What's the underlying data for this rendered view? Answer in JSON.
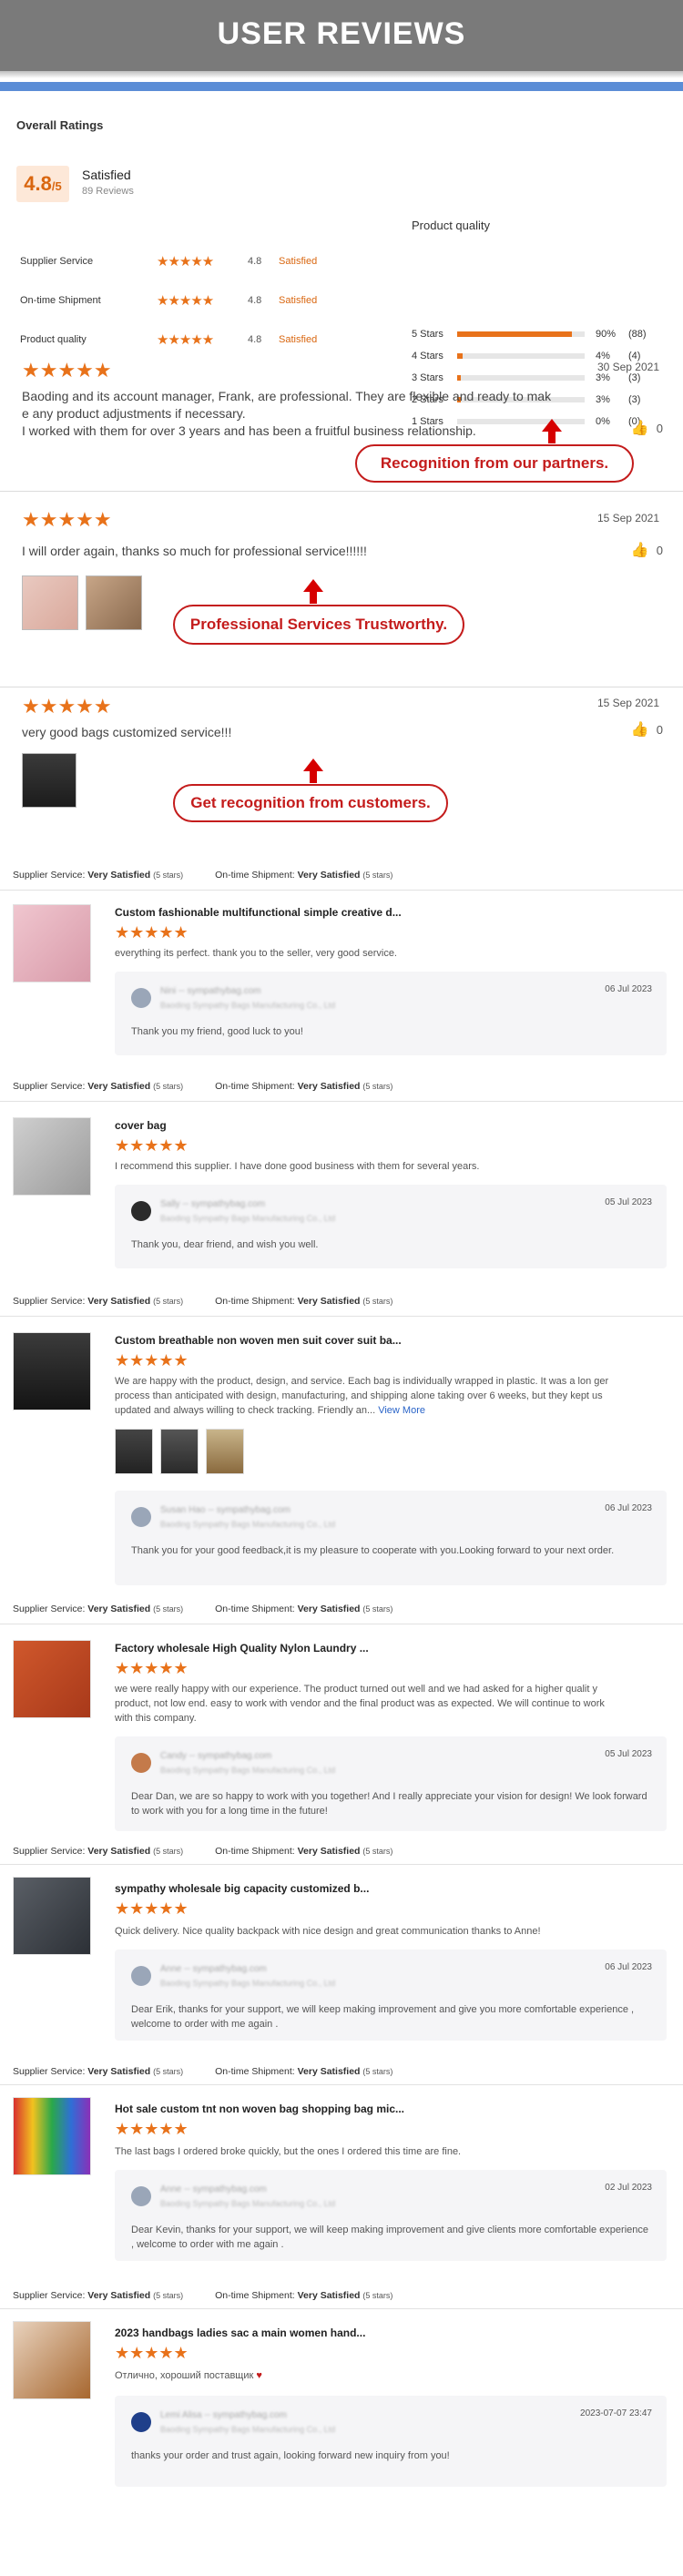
{
  "banner": {
    "title": "USER REVIEWS"
  },
  "overall": {
    "heading": "Overall Ratings",
    "score": "4.8",
    "score_of": "/5",
    "satisfaction": "Satisfied",
    "review_count": "89 Reviews",
    "categories": [
      {
        "name": "Supplier Service",
        "score": "4.8",
        "word": "Satisfied"
      },
      {
        "name": "On-time Shipment",
        "score": "4.8",
        "word": "Satisfied"
      },
      {
        "name": "Product quality",
        "score": "4.8",
        "word": "Satisfied"
      }
    ],
    "product_quality": {
      "title": "Product quality",
      "rows": [
        {
          "label": "5 Stars",
          "fraction": 0.9,
          "pct": "90%",
          "count": "(88)"
        },
        {
          "label": "4 Stars",
          "fraction": 0.04,
          "pct": "4%",
          "count": "(4)"
        },
        {
          "label": "3 Stars",
          "fraction": 0.03,
          "pct": "3%",
          "count": "(3)"
        },
        {
          "label": "2 Stars",
          "fraction": 0.03,
          "pct": "3%",
          "count": "(3)"
        },
        {
          "label": "1 Stars",
          "fraction": 0.0,
          "pct": "0%",
          "count": "(0)"
        }
      ]
    }
  },
  "top_reviews": [
    {
      "date": "30 Sep 2021",
      "text_line1": "Baoding and its account manager, Frank, are professional. They are flexible and ready to mak",
      "text_line2": "e any product adjustments if necessary.",
      "text_line3": "I worked with them for over 3 years and has been a fruitful business relationship.",
      "likes": "0",
      "callout": "Recognition from our partners."
    },
    {
      "date": "15 Sep 2021",
      "text_line1": "I will order again, thanks so much for professional service!!!!!!",
      "likes": "0",
      "callout": "Professional Services Trustworthy."
    },
    {
      "date": "15 Sep 2021",
      "text_line1": "very good bags customized service!!!",
      "likes": "0",
      "callout": "Get recognition from customers."
    }
  ],
  "service_line": {
    "supplier_label": "Supplier Service:",
    "supplier_value": "Very Satisfied",
    "supplier_stars": "(5 stars)",
    "shipment_label": "On-time Shipment:",
    "shipment_value": "Very Satisfied",
    "shipment_stars": "(5 stars)"
  },
  "product_reviews": [
    {
      "title": "Custom fashionable multifunctional simple creative d...",
      "text": "everything its perfect. thank you to the seller, very good service.",
      "reply_name": "Nini -- sympathybag.com",
      "reply_company": "Baoding Sympathy Bags Manufacturing Co., Ltd",
      "reply_date": "06 Jul 2023",
      "reply_text": "Thank you my friend, good luck to you!"
    },
    {
      "title": "cover bag",
      "text": "I recommend this supplier. I have done good business with them for several years.",
      "reply_name": "Sally -- sympathybag.com",
      "reply_company": "Baoding Sympathy Bags Manufacturing Co., Ltd",
      "reply_date": "05 Jul 2023",
      "reply_text": "Thank you, dear friend, and wish you well."
    },
    {
      "title": "Custom breathable non woven men suit cover suit ba...",
      "text": "We are happy with the product, design, and service. Each bag is individually wrapped in plastic. It was a lon ger process than anticipated with design, manufacturing, and shipping alone taking over 6 weeks, but they kept us updated and always willing to check tracking. Friendly an...",
      "more": "View More",
      "reply_name": "Susan Hao -- sympathybag.com",
      "reply_company": "Baoding Sympathy Bags Manufacturing Co., Ltd",
      "reply_date": "06 Jul 2023",
      "reply_text": "Thank you for your good feedback,it is my pleasure to cooperate with you.Looking forward to your next order."
    },
    {
      "title": "Factory wholesale High Quality Nylon Laundry ...",
      "text": "we were really happy with our experience. The product turned out well and we had asked for a higher qualit y product, not low end. easy to work with vendor and the final product was as expected. We will continue to work with this company.",
      "reply_name": "Candy -- sympathybag.com",
      "reply_company": "Baoding Sympathy Bags Manufacturing Co., Ltd",
      "reply_date": "05 Jul 2023",
      "reply_text": "Dear Dan, we are so happy to work with you together! And I really appreciate your vision for design! We look forward to work with you for a long time in the future!"
    },
    {
      "title": "sympathy wholesale big capacity customized b...",
      "text": "Quick delivery. Nice quality backpack with nice design and great communication thanks to Anne!",
      "reply_name": "Anne -- sympathybag.com",
      "reply_company": "Baoding Sympathy Bags Manufacturing Co., Ltd",
      "reply_date": "06 Jul 2023",
      "reply_text": "Dear Erik, thanks for your support, we will keep making improvement and give you more comfortable experience , welcome to order with me again ."
    },
    {
      "title": "Hot sale custom tnt non woven bag shopping bag mic...",
      "text": "The last bags I ordered broke quickly, but the ones I ordered this time are fine.",
      "reply_name": "Anne -- sympathybag.com",
      "reply_company": "Baoding Sympathy Bags Manufacturing Co., Ltd",
      "reply_date": "02 Jul 2023",
      "reply_text": "Dear Kevin, thanks for your support, we will keep making improvement and give clients more comfortable experience , welcome to order with me again ."
    },
    {
      "title": "2023 handbags ladies sac a main women hand...",
      "text": "Отлично, хороший поставщик",
      "reply_name": "Lemi Alisa -- sympathybag.com",
      "reply_company": "Baoding Sympathy Bags Manufacturing Co., Ltd",
      "reply_date": "2023-07-07 23:47",
      "reply_text": "thanks your order and trust again, looking forward new inquiry from you!"
    }
  ],
  "colors": {
    "accent": "#e8721a",
    "banner": "#7a7a7a",
    "stripe": "#5b8dd6",
    "callout": "#c41c1c"
  },
  "icons": {
    "star": "star-icon",
    "like": "thumb-up-icon"
  }
}
